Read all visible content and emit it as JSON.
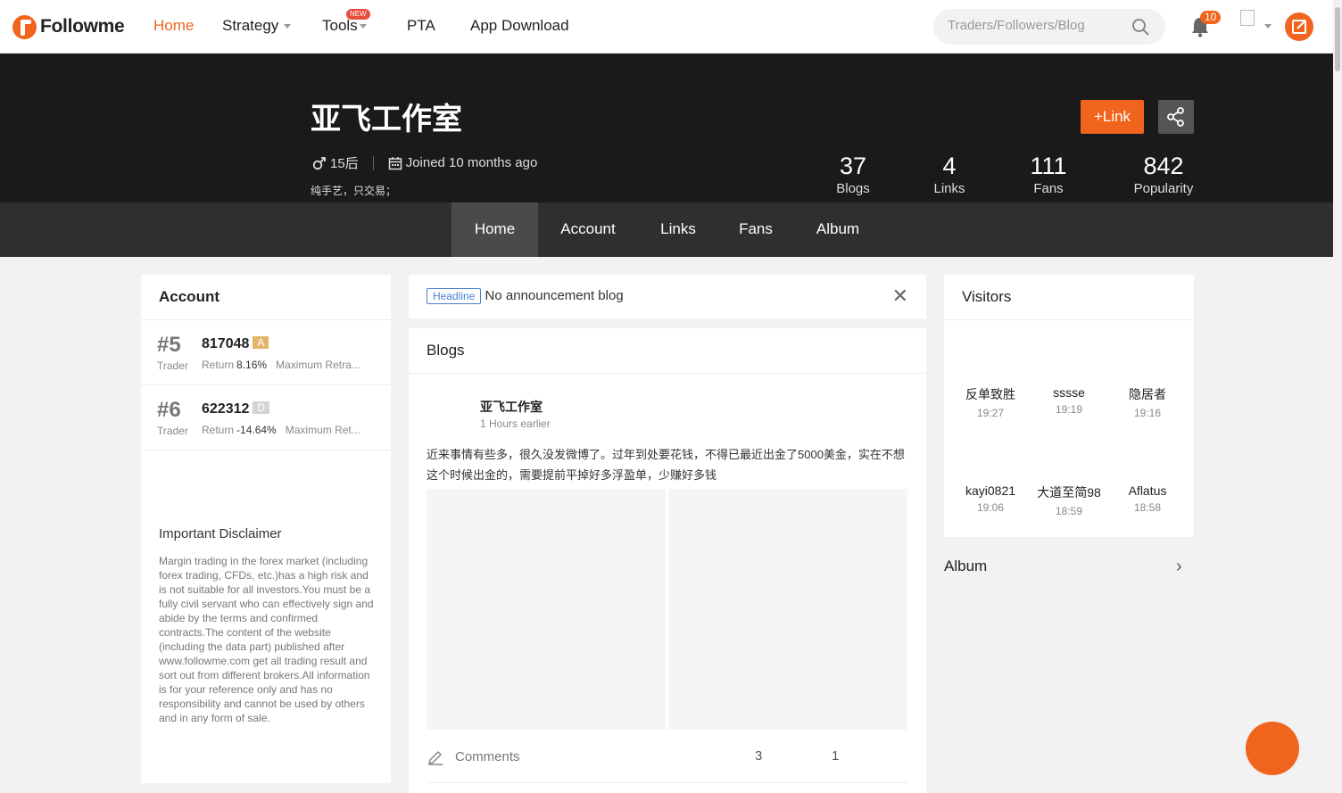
{
  "brand": {
    "name": "Followme",
    "accent": "#f0641e"
  },
  "nav": {
    "items": [
      {
        "label": "Home",
        "active": true
      },
      {
        "label": "Strategy"
      },
      {
        "label": "Tools",
        "badge": "NEW"
      },
      {
        "label": "PTA"
      },
      {
        "label": "App Download"
      }
    ],
    "search_placeholder": "Traders/Followers/Blog",
    "notification_count": "10"
  },
  "profile": {
    "name": "亚飞工作室",
    "age_tag": "15后",
    "joined": "Joined 10 months ago",
    "bio": "纯手艺，只交易；",
    "link_button": "Link",
    "stats": [
      {
        "value": "37",
        "label": "Blogs"
      },
      {
        "value": "4",
        "label": "Links"
      },
      {
        "value": "111",
        "label": "Fans"
      },
      {
        "value": "842",
        "label": "Popularity"
      }
    ]
  },
  "tabs": [
    "Home",
    "Account",
    "Links",
    "Fans",
    "Album"
  ],
  "account_card": {
    "title": "Account",
    "accounts": [
      {
        "rank": "#5",
        "role": "Trader",
        "number": "817048",
        "grade": "A",
        "grade_color": "#e2b56b",
        "return_label": "Return",
        "return_value": "8.16%",
        "drawdown_label": "Maximum Retra..."
      },
      {
        "rank": "#6",
        "role": "Trader",
        "number": "622312",
        "grade": "D",
        "grade_color": "#d4d4d4",
        "return_label": "Return",
        "return_value": "-14.64%",
        "drawdown_label": "Maximum Ret..."
      }
    ],
    "disclaimer_title": "Important Disclaimer",
    "disclaimer_text": "Margin trading in the forex market (including forex trading, CFDs, etc.)has a high risk and is not suitable for all investors.You must be a fully civil servant who can effectively sign and abide by the terms and confirmed contracts.The content of the website (including the data part) published after www.followme.com get all trading result and sort out from different brokers.All information is for your reference only and has no responsibility and cannot be used by others and in any form of sale."
  },
  "announcement": {
    "tag": "Headline",
    "text": "No announcement blog"
  },
  "blogs": {
    "title": "Blogs",
    "post": {
      "author": "亚飞工作室",
      "time": "1 Hours earlier",
      "body": "近来事情有些多，很久没发微博了。过年到处要花钱，不得已最近出金了5000美金，实在不想这个时候出金的，需要提前平掉好多浮盈单，少赚好多钱",
      "comments_label": "Comments",
      "likes": "3",
      "shares": "1"
    }
  },
  "visitors": {
    "title": "Visitors",
    "list": [
      {
        "name": "反单致胜",
        "time": "19:27"
      },
      {
        "name": "sssse",
        "time": "19:19"
      },
      {
        "name": "隐居者",
        "time": "19:16"
      },
      {
        "name": "kayi0821",
        "time": "19:06"
      },
      {
        "name": "大道至简98",
        "time": "18:59"
      },
      {
        "name": "Aflatus",
        "time": "18:58"
      }
    ]
  },
  "album": {
    "title": "Album"
  }
}
